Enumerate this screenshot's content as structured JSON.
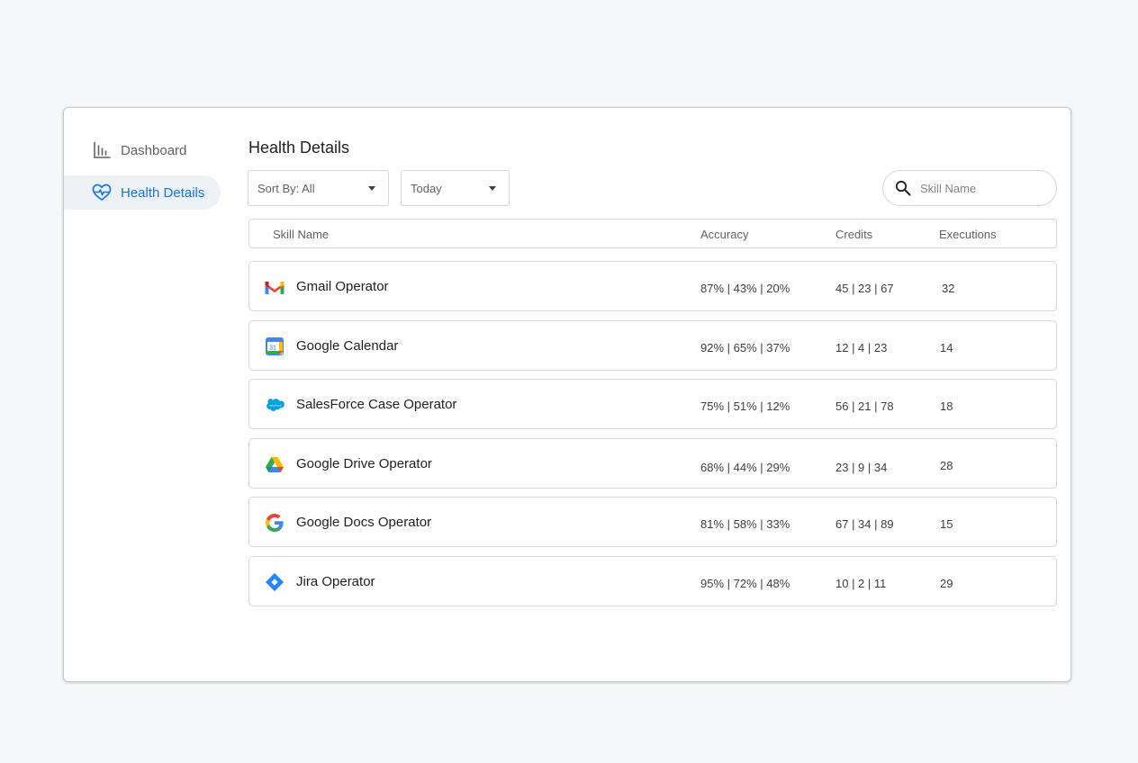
{
  "sidebar": {
    "items": [
      {
        "label": "Dashboard",
        "icon": "bar-chart-icon"
      },
      {
        "label": "Health Details",
        "icon": "heart-pulse-icon",
        "active": true
      }
    ]
  },
  "main": {
    "title": "Health Details",
    "filters": {
      "sort_label": "Sort By: All",
      "date_label": "Today"
    },
    "search": {
      "placeholder": "Skill Name",
      "icon": "search-icon"
    },
    "table": {
      "columns": [
        "Skill Name",
        "Accuracy",
        "Credits",
        "Executions"
      ],
      "rows": [
        {
          "name": "Gmail Operator",
          "icon": "gmail-icon",
          "accuracy": "87% | 43% | 20%",
          "credits": "45 | 23 | 67",
          "executions": "32"
        },
        {
          "name": "Google Calendar",
          "icon": "google-calendar-icon",
          "accuracy": "92% | 65% | 37%",
          "credits": "12 | 4 | 23",
          "executions": "14"
        },
        {
          "name": "SalesForce Case Operator",
          "icon": "salesforce-icon",
          "accuracy": "75% | 51% | 12%",
          "credits": "56 | 21 | 78",
          "executions": "18"
        },
        {
          "name": "Google Drive Operator",
          "icon": "google-drive-icon",
          "accuracy": "68% | 44% | 29%",
          "credits": "23 | 9 | 34",
          "executions": "28"
        },
        {
          "name": "Google Docs Operator",
          "icon": "google-icon",
          "accuracy": "81% | 58% | 33%",
          "credits": "67 | 34 | 89",
          "executions": "15"
        },
        {
          "name": "Jira Operator",
          "icon": "jira-icon",
          "accuracy": "95% | 72% | 48%",
          "credits": "10 | 2 | 11",
          "executions": "29"
        }
      ]
    },
    "calendar_icon_text": "31",
    "salesforce_icon_text": "salesforce"
  },
  "colors": {
    "accent": "#1a73e8",
    "border": "#d5d7db",
    "background": "#f6f7f9"
  }
}
